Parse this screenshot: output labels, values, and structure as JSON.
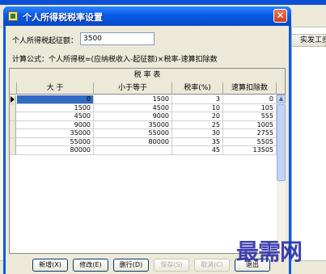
{
  "background": {
    "column_header": "实发工资"
  },
  "dialog": {
    "title": "个人所得税税率设置",
    "close_glyph": "✕",
    "start_label": "个人所得税起征额：",
    "start_value": "3500",
    "formula": "计算公式：个人所得税=(应纳税收入-起征额)×税率-速算扣除数",
    "table_caption": "税 率 表",
    "columns": [
      "大 于",
      "小于等于",
      "税率(%)",
      "速算扣除数"
    ],
    "rows": [
      [
        "0",
        "1500",
        "3",
        "0"
      ],
      [
        "1500",
        "4500",
        "10",
        "105"
      ],
      [
        "4500",
        "9000",
        "20",
        "555"
      ],
      [
        "9000",
        "35000",
        "25",
        "1005"
      ],
      [
        "35000",
        "55000",
        "30",
        "2755"
      ],
      [
        "55000",
        "80000",
        "35",
        "5505"
      ],
      [
        "80000",
        "",
        "45",
        "13505"
      ]
    ],
    "buttons": {
      "add": "新增(X)",
      "edit": "修改(E)",
      "delete": "删行(D)",
      "save": "保存(S)",
      "cancel": "取消(C)",
      "exit": "退出"
    }
  },
  "watermark": "最需网"
}
